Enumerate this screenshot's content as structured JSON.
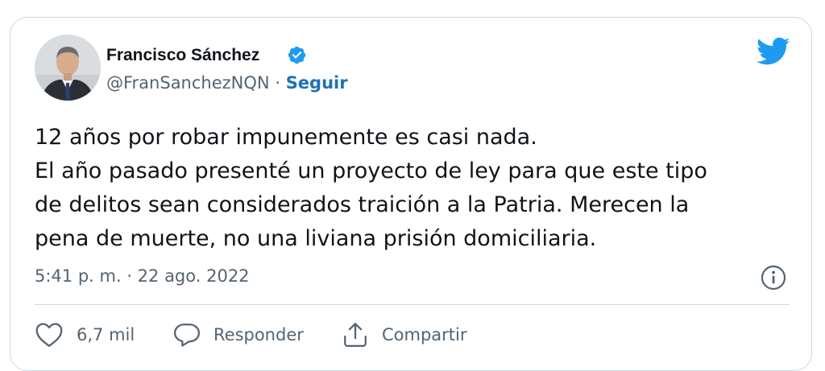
{
  "author": {
    "name": "Francisco Sánchez",
    "handle": "@FranSanchezNQN",
    "separator": "·",
    "follow_label": "Seguir",
    "verified_icon": "verified-badge-icon",
    "avatar_icon": "avatar"
  },
  "tweet": {
    "lines": [
      "12 años por robar impunemente es casi nada.",
      "El año pasado presenté un proyecto de ley para que este tipo",
      "de delitos sean considerados traición a la Patria. Merecen la",
      "pena de muerte, no una liviana prisión domiciliaria."
    ],
    "timestamp": "5:41 p. m. · 22 ago. 2022"
  },
  "actions": {
    "like_count": "6,7 mil",
    "reply_label": "Responder",
    "share_label": "Compartir"
  },
  "colors": {
    "twitter_blue": "#1d9bf0",
    "follow_blue": "#1d70b8",
    "muted_text": "#536471",
    "border": "#cfd9de"
  }
}
